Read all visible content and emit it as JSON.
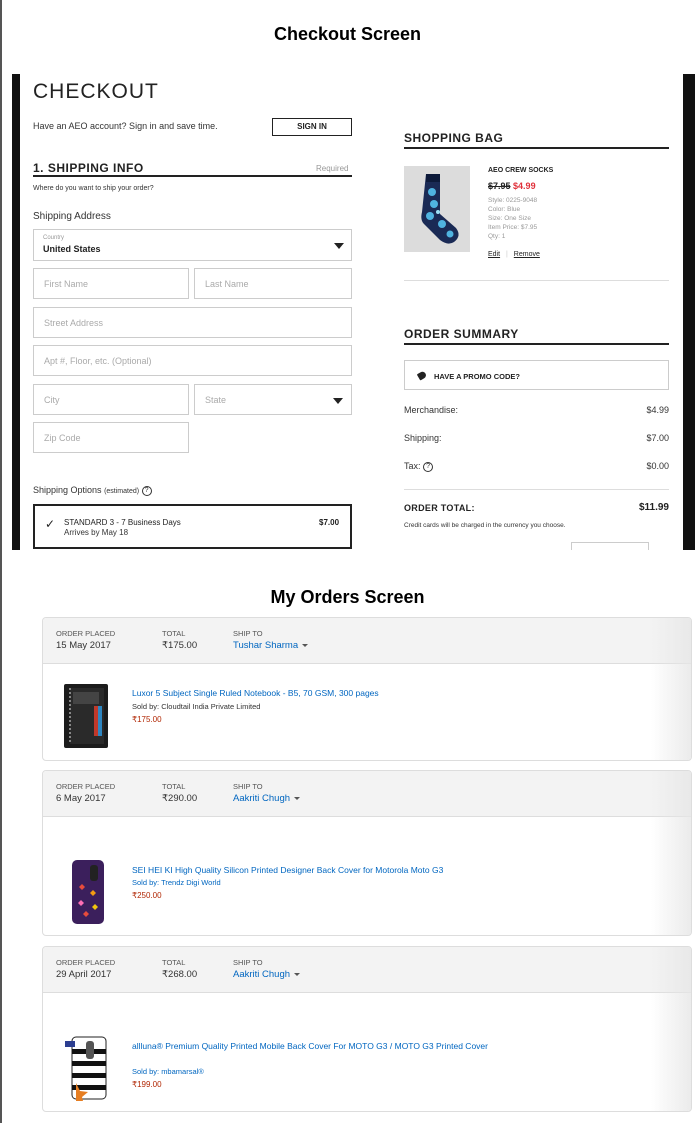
{
  "checkout_screen_title": "Checkout Screen",
  "orders_screen_title": "My Orders Screen",
  "checkout": {
    "heading": "CHECKOUT",
    "aeo_prompt": "Have an AEO account? Sign in and save time.",
    "sign_in_label": "SIGN IN",
    "shipping_info_title": "1. SHIPPING INFO",
    "required_label": "Required",
    "where_ship": "Where do you want to ship your order?",
    "shipping_address_label": "Shipping Address",
    "country_label": "Country",
    "country_value": "United States",
    "first_name_placeholder": "First Name",
    "last_name_placeholder": "Last Name",
    "street_placeholder": "Street Address",
    "apt_placeholder": "Apt #, Floor, etc. (Optional)",
    "city_placeholder": "City",
    "state_placeholder": "State",
    "zip_placeholder": "Zip Code",
    "shipping_options_label": "Shipping Options",
    "shipping_options_note": "(estimated)",
    "help_glyph": "?",
    "standard_option": {
      "name": "STANDARD  3 - 7 Business Days",
      "arrival": "Arrives by May 18",
      "price": "$7.00",
      "check_glyph": "✓"
    },
    "shopping_bag_title": "SHOPPING BAG",
    "bag_item": {
      "name": "AEO CREW SOCKS",
      "old_price": "$7.95",
      "new_price": "$4.99",
      "style": "Style: 0225-9048",
      "color": "Color: Blue",
      "size": "Size: One Size",
      "item_price": "Item Price: $7.95",
      "qty": "Qty: 1",
      "edit_label": "Edit",
      "remove_label": "Remove"
    },
    "order_summary_title": "ORDER SUMMARY",
    "promo_label": "HAVE A PROMO CODE?",
    "merchandise_label": "Merchandise:",
    "merchandise_value": "$4.99",
    "shipping_label": "Shipping:",
    "shipping_value": "$7.00",
    "tax_label": "Tax:",
    "tax_value": "$0.00",
    "order_total_label": "ORDER TOTAL:",
    "order_total_value": "$11.99",
    "currency_note": "Credit cards will be charged in the currency you choose."
  },
  "orders_labels": {
    "order_placed": "ORDER PLACED",
    "total": "TOTAL",
    "ship_to": "SHIP TO"
  },
  "orders": [
    {
      "date": "15 May 2017",
      "total": "₹175.00",
      "ship_to": "Tushar Sharma",
      "title": "Luxor 5 Subject Single Ruled Notebook - B5, 70 GSM, 300 pages",
      "sold_by_prefix": "Sold by: ",
      "seller": "Cloudtail India Private Limited",
      "price": "₹175.00"
    },
    {
      "date": "6 May 2017",
      "total": "₹290.00",
      "ship_to": "Aakriti Chugh",
      "title": "SEI HEI KI High Quality Silicon Printed Designer Back Cover for Motorola Moto G3",
      "sold_by_prefix": "Sold by: ",
      "seller": "Trendz Digi World",
      "price": "₹250.00"
    },
    {
      "date": "29 April 2017",
      "total": "₹268.00",
      "ship_to": "Aakriti Chugh",
      "title": "allluna® Premium Quality Printed Mobile Back Cover For MOTO G3 / MOTO G3 Printed Cover",
      "sold_by_prefix": "Sold by: ",
      "seller": "mbamarsal®",
      "price": "₹199.00"
    }
  ]
}
